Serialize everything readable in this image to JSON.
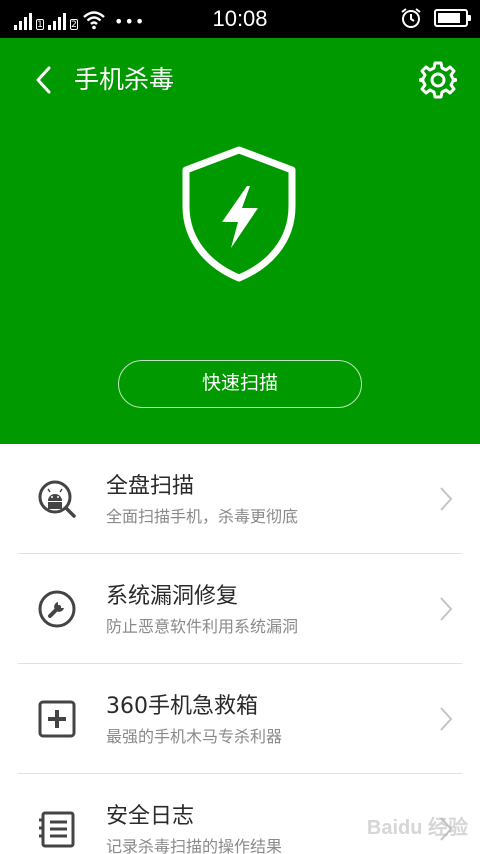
{
  "status_bar": {
    "sim1": "1",
    "sim2": "2",
    "dots": "•••",
    "time": "10:08",
    "battery_level": 0.85
  },
  "header": {
    "title": "手机杀毒",
    "back_icon": "chevron-left-icon",
    "settings_icon": "gear-icon",
    "shield_icon": "shield-lightning-icon",
    "scan_button": "快速扫描",
    "bg_color": "#009a00"
  },
  "list": {
    "items": [
      {
        "title": "全盘扫描",
        "subtitle": "全面扫描手机，杀毒更彻底",
        "icon": "android-search-icon"
      },
      {
        "title": "系统漏洞修复",
        "subtitle": "防止恶意软件利用系统漏洞",
        "icon": "wrench-icon"
      },
      {
        "title": "360手机急救箱",
        "subtitle": "最强的手机木马专杀利器",
        "icon": "first-aid-icon"
      },
      {
        "title": "安全日志",
        "subtitle": "记录杀毒扫描的操作结果",
        "icon": "log-list-icon"
      }
    ],
    "chevron_icon": "chevron-right-icon"
  },
  "watermark": "Baidu 经验"
}
